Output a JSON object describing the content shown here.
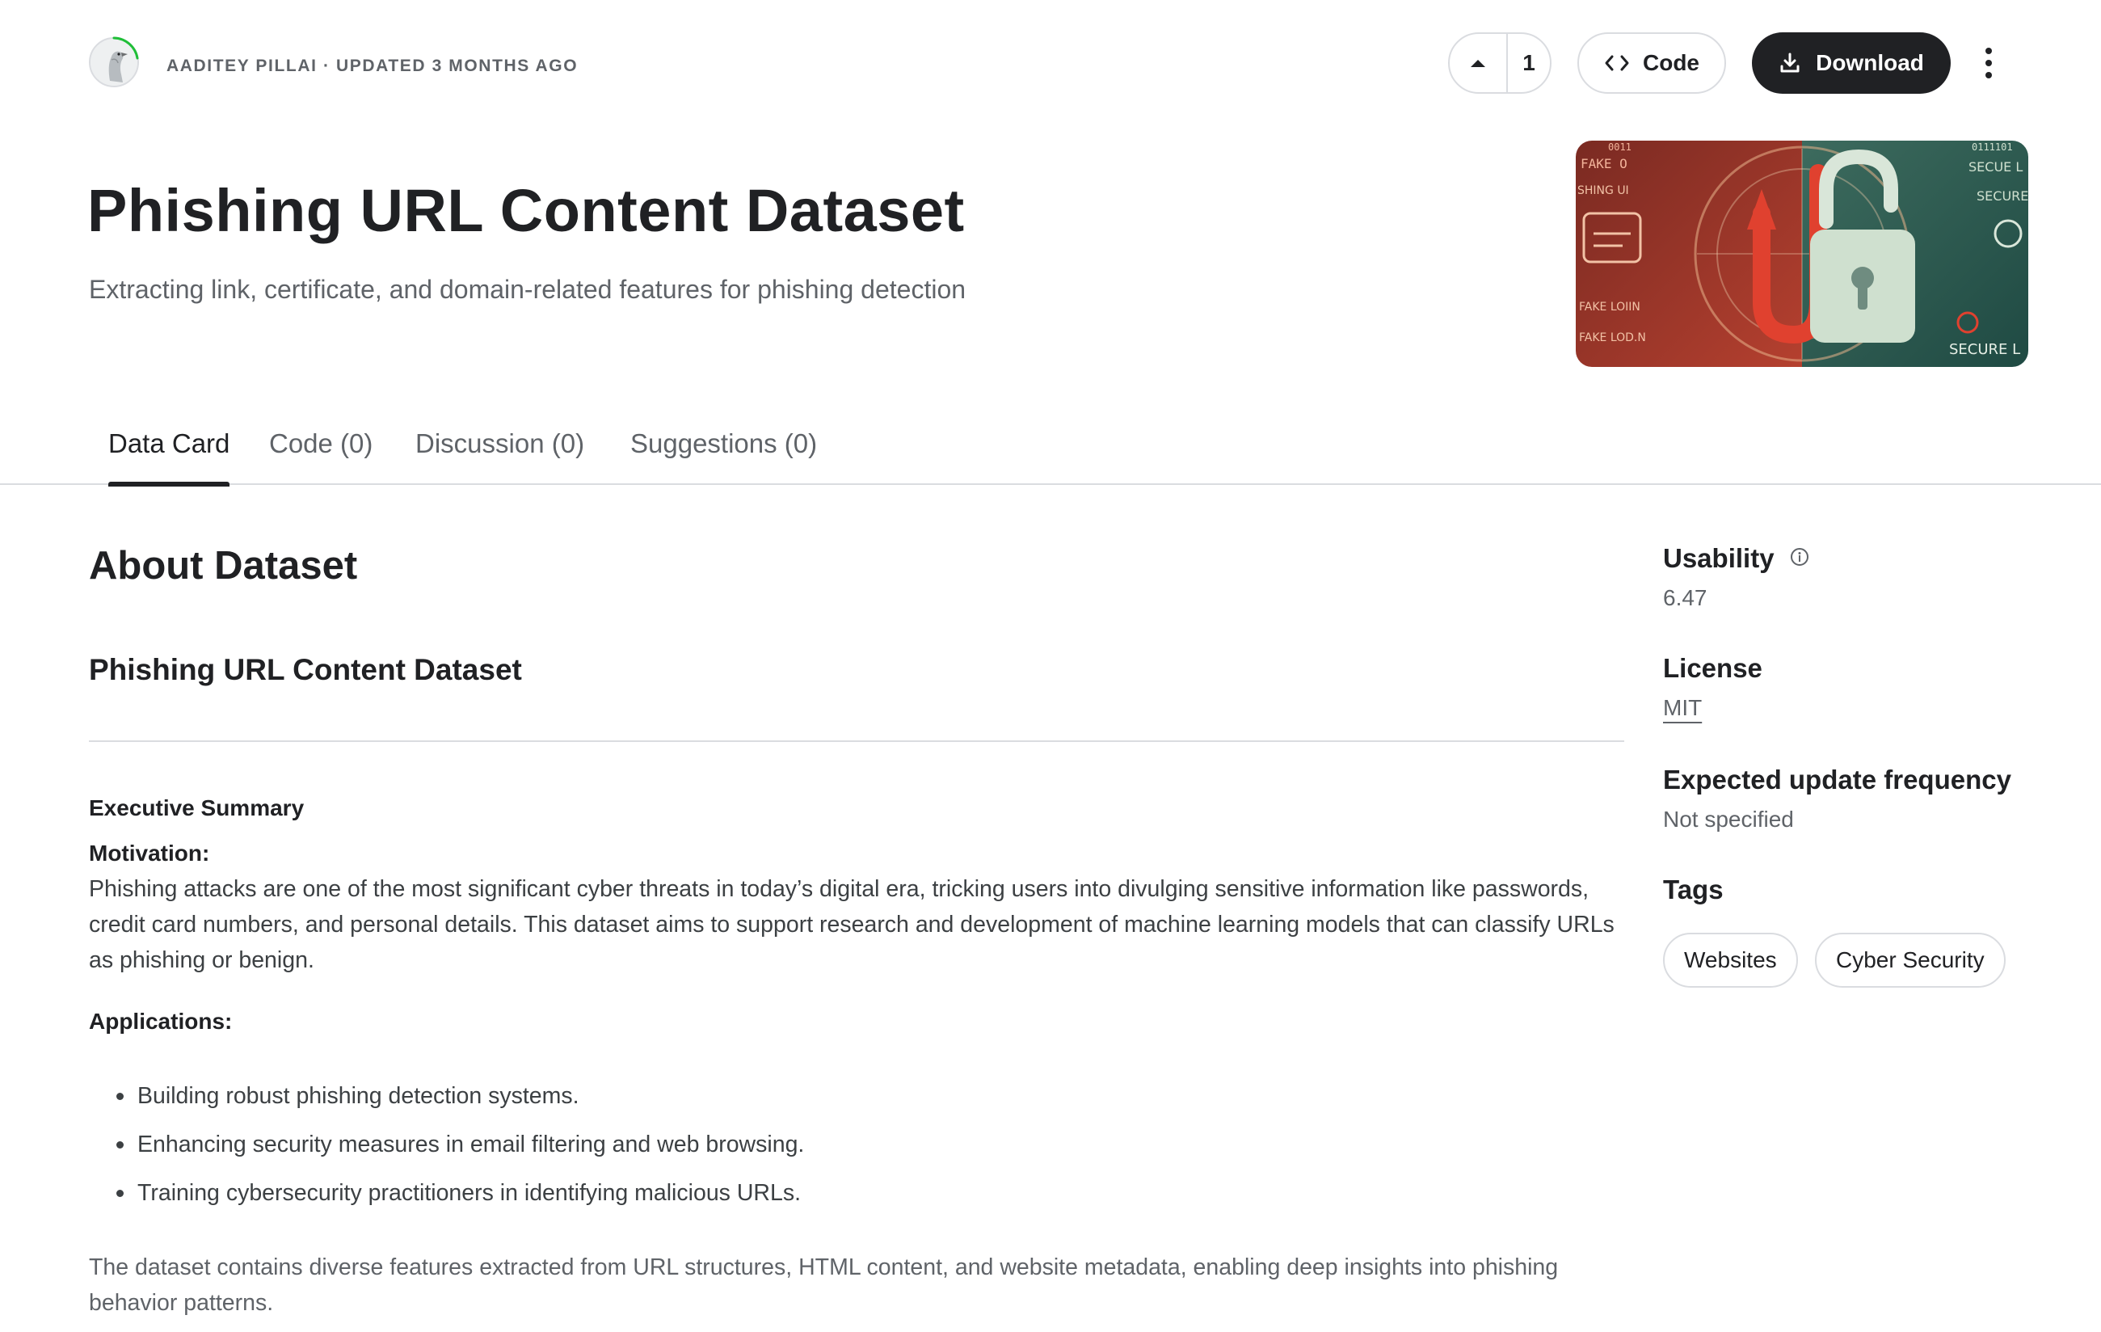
{
  "header": {
    "byline": "AADITEY PILLAI · UPDATED 3 MONTHS AGO",
    "vote_count": "1",
    "code_label": "Code",
    "download_label": "Download",
    "title": "Phishing URL Content Dataset",
    "subtitle": "Extracting link, certificate, and domain-related features for phishing detection",
    "cover_texts": [
      "FAKE O",
      "SHING UI",
      "FAKE LOIIN",
      "FAKE LOD.N",
      "SECUE L",
      "SECURE",
      "SECURE L",
      "0011",
      "0111101"
    ]
  },
  "tabs": [
    {
      "label": "Data Card"
    },
    {
      "label": "Code (0)"
    },
    {
      "label": "Discussion (0)"
    },
    {
      "label": "Suggestions (0)"
    }
  ],
  "content": {
    "about_title": "About Dataset",
    "dataset_heading": "Phishing URL Content Dataset",
    "exec_summary": "Executive Summary",
    "motivation_label": "Motivation:",
    "motivation_text": "Phishing attacks are one of the most significant cyber threats in today’s digital era, tricking users into divulging sensitive information like passwords, credit card numbers, and personal details. This dataset aims to support research and development of machine learning models that can classify URLs as phishing or benign.",
    "applications_label": "Applications:",
    "applications": [
      "Building robust phishing detection systems.",
      "Enhancing security measures in email filtering and web browsing.",
      "Training cybersecurity practitioners in identifying malicious URLs."
    ],
    "closing_text": "The dataset contains diverse features extracted from URL structures, HTML content, and website metadata, enabling deep insights into phishing behavior patterns."
  },
  "sidebar": {
    "usability_label": "Usability",
    "usability_value": "6.47",
    "license_label": "License",
    "license_value": "MIT",
    "frequency_label": "Expected update frequency",
    "frequency_value": "Not specified",
    "tags_label": "Tags",
    "tags": [
      "Websites",
      "Cyber Security"
    ]
  },
  "colors": {
    "text_primary": "#202124",
    "text_secondary": "#5f6368",
    "border": "#dadce0",
    "download_bg": "#202124",
    "avatar_ring": "#20be38"
  },
  "icons": {
    "upvote": "caret-up-icon",
    "code": "code-brackets-icon",
    "download": "download-icon",
    "more": "more-vertical-icon",
    "info": "info-icon"
  }
}
